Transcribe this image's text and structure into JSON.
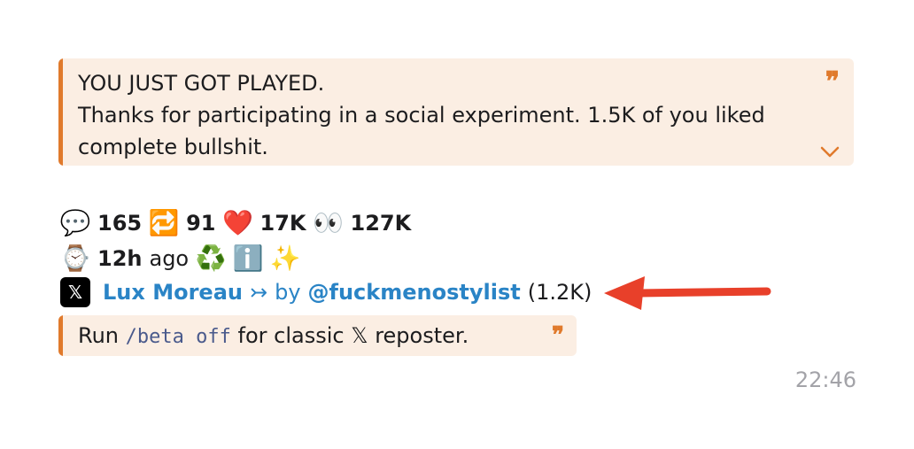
{
  "quote_top": {
    "line1": "YOU JUST GOT PLAYED.",
    "line2": "Thanks for participating in a social experiment. 1.5K of you liked",
    "line3": "complete bullshit."
  },
  "stats": {
    "replies_icon": "speech-bubble-emoji",
    "replies": "165",
    "reposts_icon": "repeat-emoji",
    "reposts": "91",
    "likes_icon": "red-heart-emoji",
    "likes": "17K",
    "views_icon": "eyes-emoji",
    "views": "127K"
  },
  "time_row": {
    "watch_icon": "watch-emoji",
    "ago_value": "12h",
    "ago_label": "ago",
    "recycle_icon": "recycle-emoji",
    "info_icon": "info-emoji",
    "sparkles_icon": "sparkles-emoji"
  },
  "author": {
    "x_logo": "𝕏",
    "name": "Lux Moreau",
    "arrow": "↣",
    "by": "by",
    "handle": "@fuckmenostylist",
    "count": "(1.2K)"
  },
  "quote_bottom": {
    "before": "Run",
    "code": "/beta off",
    "after": "for classic 𝕏 reposter."
  },
  "quote_mark": "❞",
  "timestamp": "22:46",
  "colors": {
    "accent": "#e07a2c",
    "quote_bg": "#fbeee3",
    "link": "#2a84c6",
    "arrow": "#e8402a",
    "timestamp": "#a3a3a8"
  }
}
